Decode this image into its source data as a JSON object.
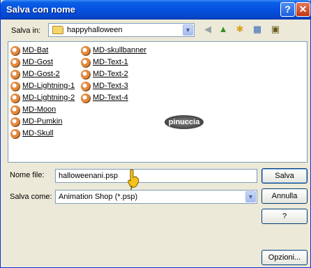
{
  "titlebar": {
    "title": "Salva con nome",
    "help_label": "?",
    "close_label": "✕"
  },
  "location": {
    "label": "Salva in:",
    "folder": "happyhalloween"
  },
  "toolbar": {
    "back_icon": "back-arrow-icon",
    "up_icon": "folder-up-icon",
    "new_folder_icon": "new-folder-icon",
    "views_icon": "view-menu-icon",
    "tools_icon": "tools-icon"
  },
  "files": [
    "MD-Bat",
    "MD-Gost",
    "MD-Gost-2",
    "MD-Lightning-1",
    "MD-Lightning-2",
    "MD-Moon",
    "MD-Pumkin",
    "MD-Skull",
    "MD-skullbanner",
    "MD-Text-1",
    "MD-Text-2",
    "MD-Text-3",
    "MD-Text-4"
  ],
  "watermark": "pinuccia",
  "filename": {
    "label": "Nome file:",
    "value": "halloweenani.psp"
  },
  "filetype": {
    "label": "Salva come:",
    "value": "Animation Shop (*.psp)"
  },
  "buttons": {
    "save": "Salva",
    "cancel": "Annulla",
    "help": "?",
    "options": "Opzioni..."
  }
}
